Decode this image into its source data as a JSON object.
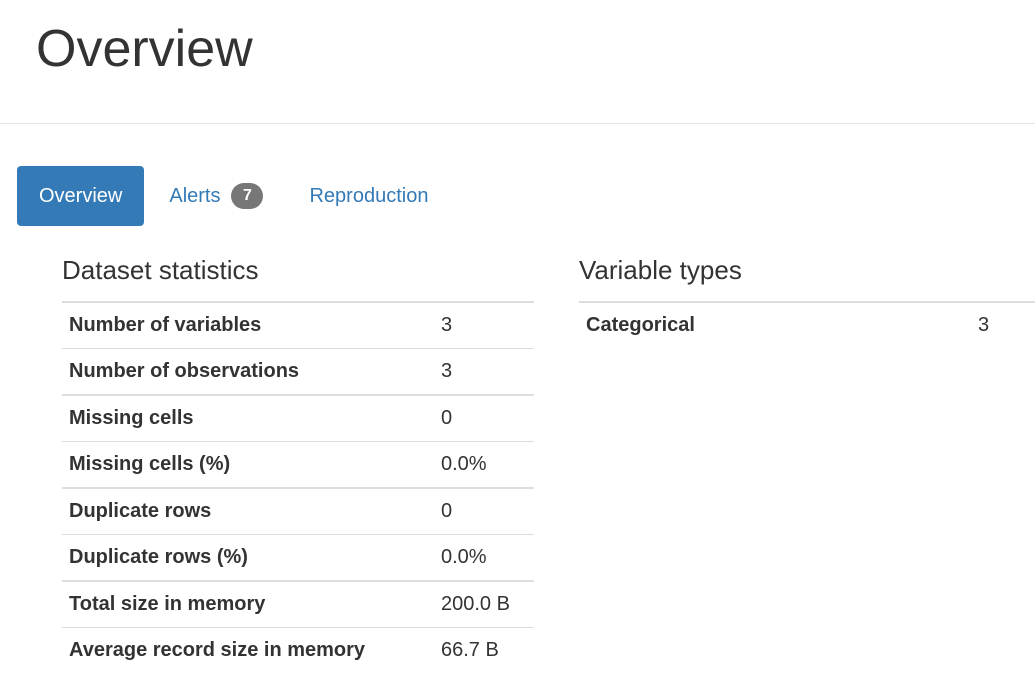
{
  "page": {
    "title": "Overview"
  },
  "tabs": [
    {
      "label": "Overview",
      "active": true
    },
    {
      "label": "Alerts",
      "badge": "7"
    },
    {
      "label": "Reproduction"
    }
  ],
  "dataset_statistics": {
    "title": "Dataset statistics",
    "rows": [
      {
        "label": "Number of variables",
        "value": "3"
      },
      {
        "label": "Number of observations",
        "value": "3"
      },
      {
        "label": "Missing cells",
        "value": "0"
      },
      {
        "label": "Missing cells (%)",
        "value": "0.0%"
      },
      {
        "label": "Duplicate rows",
        "value": "0"
      },
      {
        "label": "Duplicate rows (%)",
        "value": "0.0%"
      },
      {
        "label": "Total size in memory",
        "value": "200.0 B"
      },
      {
        "label": "Average record size in memory",
        "value": "66.7 B"
      }
    ]
  },
  "variable_types": {
    "title": "Variable types",
    "rows": [
      {
        "label": "Categorical",
        "value": "3"
      }
    ]
  },
  "colors": {
    "accent": "#337ab7",
    "badge": "#777777",
    "text": "#333333",
    "rule": "#dddddd"
  }
}
